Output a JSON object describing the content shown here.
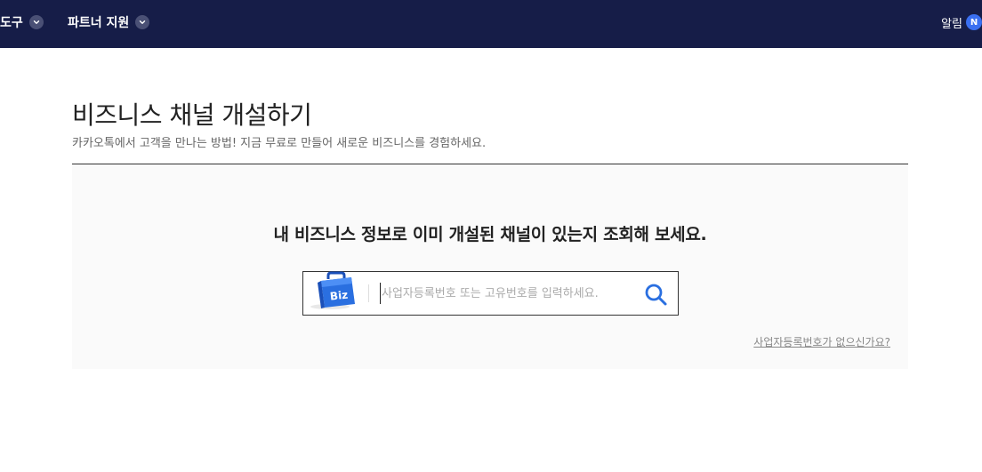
{
  "nav": {
    "tools_label": "도구",
    "partner_label": "파트너 지원",
    "notice_label": "알림",
    "notice_badge": "N"
  },
  "page": {
    "title": "비즈니스 채널 개설하기",
    "subtitle": "카카오톡에서 고객을 만나는 방법! 지금 무료로 만들어 새로운 비즈니스를 경험하세요."
  },
  "search": {
    "heading": "내 비즈니스 정보로 이미 개설된 채널이 있는지 조회해 보세요.",
    "logo_text": "Biz",
    "placeholder": "사업자등록번호 또는 고유번호를 입력하세요.",
    "value": "",
    "help_link": "사업자등록번호가 없으신가요?"
  },
  "colors": {
    "topbar": "#161d48",
    "accent_blue": "#2a6fe0",
    "badge_blue": "#3a6ff0"
  }
}
